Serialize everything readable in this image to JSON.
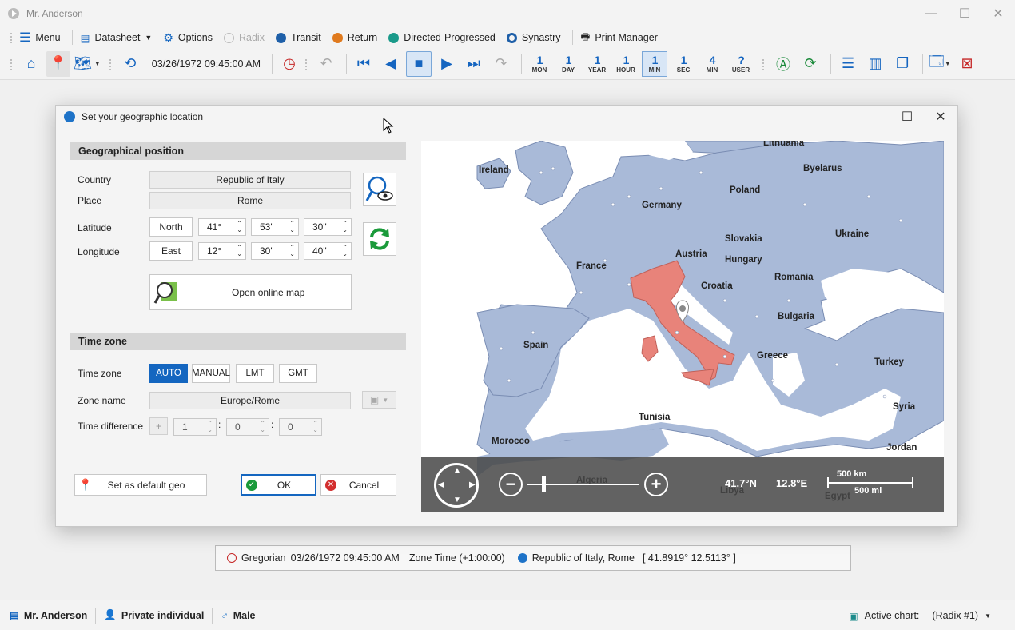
{
  "window": {
    "title": "Mr. Anderson"
  },
  "menu": {
    "menu": "Menu",
    "datasheet": "Datasheet",
    "options": "Options",
    "radix": "Radix",
    "transit": "Transit",
    "return": "Return",
    "directed": "Directed-Progressed",
    "synastry": "Synastry",
    "print_manager": "Print Manager"
  },
  "toolbar": {
    "datetime": "03/26/1972 09:45:00 AM",
    "units": [
      {
        "n": "1",
        "l": "MON"
      },
      {
        "n": "1",
        "l": "DAY"
      },
      {
        "n": "1",
        "l": "YEAR"
      },
      {
        "n": "1",
        "l": "HOUR"
      },
      {
        "n": "1",
        "l": "MIN"
      },
      {
        "n": "1",
        "l": "SEC"
      },
      {
        "n": "4",
        "l": "MIN"
      },
      {
        "n": "?",
        "l": "USER"
      }
    ]
  },
  "dialog": {
    "title": "Set your geographic location",
    "geo_section": "Geographical position",
    "country_label": "Country",
    "country_value": "Republic of Italy",
    "place_label": "Place",
    "place_value": "Rome",
    "latitude_label": "Latitude",
    "lat_dir": "North",
    "lat_deg": "41°",
    "lat_min": "53'",
    "lat_sec": "30\"",
    "longitude_label": "Longitude",
    "lon_dir": "East",
    "lon_deg": "12°",
    "lon_min": "30'",
    "lon_sec": "40\"",
    "online_map": "Open online map",
    "tz_section": "Time zone",
    "tz_label": "Time zone",
    "tz_auto": "AUTO",
    "tz_manual": "MANUAL",
    "tz_lmt": "LMT",
    "tz_gmt": "GMT",
    "zone_name_label": "Zone name",
    "zone_name_value": "Europe/Rome",
    "time_diff_label": "Time difference",
    "td_sign": "+",
    "td_h": "1",
    "td_m": "0",
    "td_s": "0",
    "default_geo": "Set as default geo",
    "ok": "OK",
    "cancel": "Cancel"
  },
  "map": {
    "lat_readout": "41.7°N",
    "lon_readout": "12.8°E",
    "scale_km": "500 km",
    "scale_mi": "500 mi",
    "labels": [
      "Lithuania",
      "Ireland",
      "Byelarus",
      "Germany",
      "Poland",
      "Ukraine",
      "Slovakia",
      "France",
      "Austria",
      "Hungary",
      "Croatia",
      "Romania",
      "Bulgaria",
      "Spain",
      "Greece",
      "Turkey",
      "Tunisia",
      "Syria",
      "Morocco",
      "Jordan",
      "Algeria",
      "Libya",
      "Egypt"
    ]
  },
  "status": {
    "calendar": "Gregorian",
    "datetime": "03/26/1972 09:45:00 AM",
    "zone": "Zone Time (+1:00:00)",
    "location": "Republic of Italy, Rome",
    "coords": "[ 41.8919°  12.5113° ]"
  },
  "bottom": {
    "person": "Mr. Anderson",
    "type": "Private individual",
    "gender": "Male",
    "active_chart_label": "Active chart:",
    "active_chart_value": "(Radix #1)"
  },
  "colors": {
    "accent": "#1466c0",
    "land": "#a9bad8",
    "highlight": "#e8837a",
    "sea": "#ffffff"
  }
}
